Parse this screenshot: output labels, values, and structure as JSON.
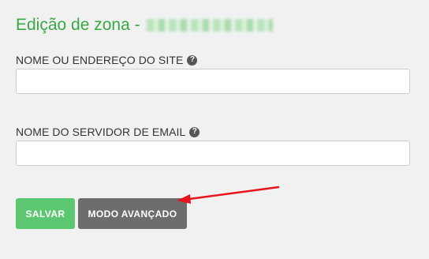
{
  "page": {
    "title": "Edição de zona -"
  },
  "fields": [
    {
      "label": "NOME OU ENDEREÇO DO SITE",
      "help_icon": "question-circle-icon",
      "value": "",
      "placeholder": ""
    },
    {
      "label": "NOME DO SERVIDOR DE EMAIL",
      "help_icon": "question-circle-icon",
      "value": "",
      "placeholder": ""
    }
  ],
  "actions": {
    "save_label": "SALVAR",
    "advanced_label": "MODO AVANÇADO"
  },
  "help_glyph": "?",
  "colors": {
    "title": "#3aa844",
    "save_button": "#5cc771",
    "advanced_button": "#6d6d6d",
    "annotation_arrow": "#e8141c",
    "background": "#f1f1f1"
  }
}
